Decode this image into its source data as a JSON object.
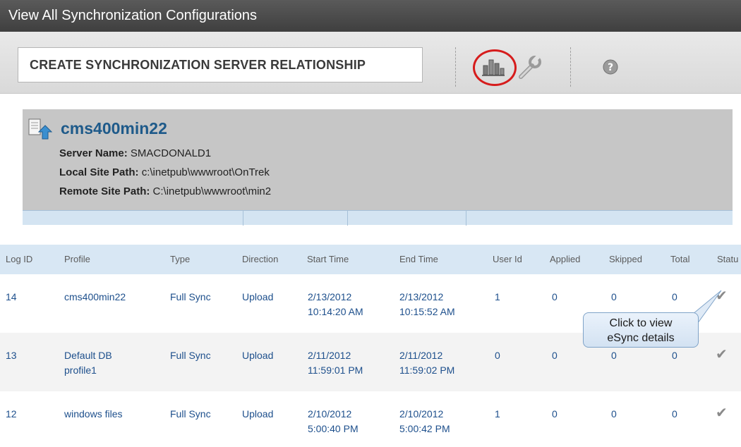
{
  "window": {
    "title": "View All Synchronization Configurations"
  },
  "toolbar": {
    "create_label": "CREATE SYNCHRONIZATION SERVER RELATIONSHIP",
    "icons": [
      "bar-chart-icon",
      "wrench-icon",
      "help-icon"
    ],
    "highlight_color": "#d61c1c"
  },
  "server": {
    "name": "cms400min22",
    "server_name_label": "Server Name:",
    "server_name_value": "SMACDONALD1",
    "local_label": "Local Site Path:",
    "local_value": "c:\\inetpub\\wwwroot\\OnTrek",
    "remote_label": "Remote Site Path:",
    "remote_value": "C:\\inetpub\\wwwroot\\min2"
  },
  "table": {
    "headers": [
      "Log ID",
      "Profile",
      "Type",
      "Direction",
      "Start Time",
      "End Time",
      "User Id",
      "Applied",
      "Skipped",
      "Total",
      "Statu"
    ],
    "rows": [
      {
        "log_id": "14",
        "profile": [
          "cms400min22",
          ""
        ],
        "type": "Full Sync",
        "direction": "Upload",
        "start": [
          "2/13/2012",
          "10:14:20 AM"
        ],
        "end": [
          "2/13/2012",
          "10:15:52 AM"
        ],
        "user": "1",
        "applied": "0",
        "skipped": "0",
        "total": "0"
      },
      {
        "log_id": "13",
        "profile": [
          "Default DB",
          "profile1"
        ],
        "type": "Full Sync",
        "direction": "Upload",
        "start": [
          "2/11/2012",
          "11:59:01 PM"
        ],
        "end": [
          "2/11/2012",
          "11:59:02 PM"
        ],
        "user": "0",
        "applied": "0",
        "skipped": "0",
        "total": "0"
      },
      {
        "log_id": "12",
        "profile": [
          "windows files",
          ""
        ],
        "type": "Full Sync",
        "direction": "Upload",
        "start": [
          "2/10/2012",
          "5:00:40 PM"
        ],
        "end": [
          "2/10/2012",
          "5:00:42 PM"
        ],
        "user": "1",
        "applied": "0",
        "skipped": "0",
        "total": "0"
      }
    ]
  },
  "callout": {
    "line1": "Click to view",
    "line2": "eSync details"
  }
}
